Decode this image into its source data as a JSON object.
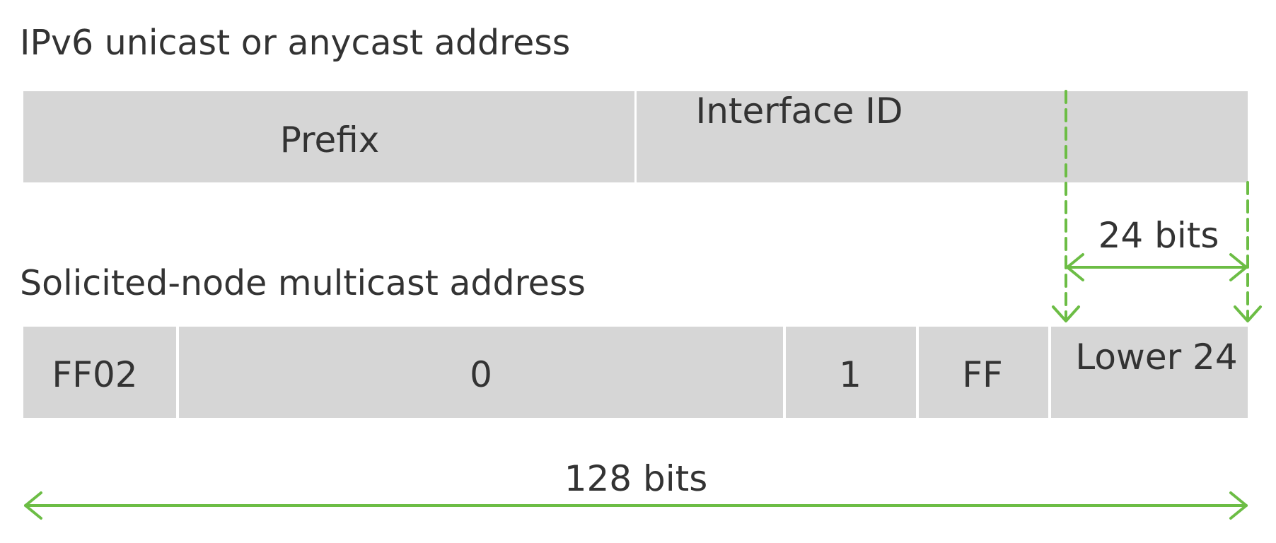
{
  "colors": {
    "field": "#d6d6d6",
    "text": "#333333",
    "accent": "#6cbd45"
  },
  "top": {
    "title": "IPv6 unicast or anycast address",
    "fields": {
      "prefix": "Prefix",
      "interface_id": "Interface ID"
    }
  },
  "bottom": {
    "title": "Solicited-node multicast address",
    "fields": {
      "ff02": "FF02",
      "zero": "0",
      "one": "1",
      "ff": "FF",
      "lower24": "Lower 24"
    }
  },
  "measures": {
    "lower_bits": "24 bits",
    "total_bits": "128 bits"
  }
}
